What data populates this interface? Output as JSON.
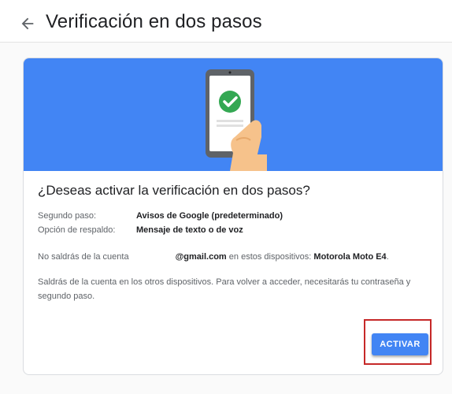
{
  "header": {
    "title": "Verificación en dos pasos",
    "back_icon": "arrow-back-icon"
  },
  "card": {
    "illustration": "phone-check-icon",
    "question": "¿Deseas activar la verificación en dos pasos?",
    "details": [
      {
        "label": "Segundo paso:",
        "value": "Avisos de Google (predeterminado)"
      },
      {
        "label": "Opción de respaldo:",
        "value": "Mensaje de texto o de voz"
      }
    ],
    "stay_signed_in": {
      "prefix": "No saldrás de la cuenta",
      "email": "@gmail.com",
      "middle": "en estos dispositivos:",
      "device": "Motorola Moto E4",
      "suffix": "."
    },
    "signout_notice": "Saldrás de la cuenta en los otros dispositivos. Para volver a acceder, necesitarás tu contraseña y segundo paso.",
    "activate_label": "ACTIVAR"
  },
  "colors": {
    "accent": "#4285f4",
    "highlight_box": "#c62828",
    "check": "#34a853"
  }
}
